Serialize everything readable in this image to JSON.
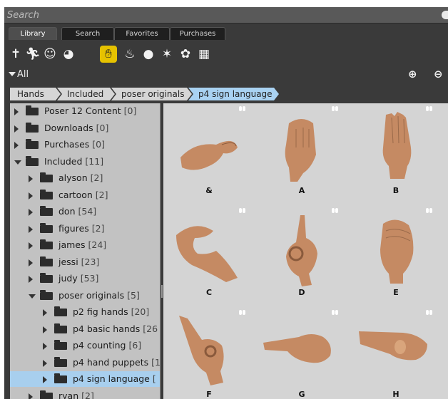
{
  "search": {
    "placeholder": "Search"
  },
  "tabs": [
    {
      "label": "Library"
    },
    {
      "label": "Search"
    },
    {
      "label": "Favorites"
    },
    {
      "label": "Purchases"
    }
  ],
  "toolbar": {
    "icons": [
      "figure-icon",
      "pose-icon",
      "expression-icon",
      "hair-icon",
      "hand-icon",
      "props-icon",
      "light-icon",
      "camera-icon",
      "materials-icon",
      "scenes-icon"
    ],
    "active_icon": "hand-icon"
  },
  "filter": {
    "label": "All",
    "add_icon": "add-library-icon",
    "remove_icon": "remove-library-icon"
  },
  "breadcrumb": [
    "Hands",
    "Included",
    "poser originals",
    "p4 sign language"
  ],
  "tree": [
    {
      "label": "Poser 12 Content",
      "count": "[0]",
      "state": "collapsed",
      "level": 0
    },
    {
      "label": "Downloads",
      "count": "[0]",
      "state": "collapsed",
      "level": 0
    },
    {
      "label": "Purchases",
      "count": "[0]",
      "state": "collapsed",
      "level": 0
    },
    {
      "label": "Included",
      "count": "[11]",
      "state": "expanded",
      "level": 0
    },
    {
      "label": "alyson",
      "count": "[2]",
      "state": "collapsed",
      "level": 1
    },
    {
      "label": "cartoon",
      "count": "[2]",
      "state": "collapsed",
      "level": 1
    },
    {
      "label": "don",
      "count": "[54]",
      "state": "collapsed",
      "level": 1
    },
    {
      "label": "figures",
      "count": "[2]",
      "state": "collapsed",
      "level": 1
    },
    {
      "label": "james",
      "count": "[24]",
      "state": "collapsed",
      "level": 1
    },
    {
      "label": "jessi",
      "count": "[23]",
      "state": "collapsed",
      "level": 1
    },
    {
      "label": "judy",
      "count": "[53]",
      "state": "collapsed",
      "level": 1
    },
    {
      "label": "poser originals",
      "count": "[5]",
      "state": "expanded",
      "level": 1
    },
    {
      "label": "p2 fig hands",
      "count": "[20]",
      "state": "collapsed",
      "level": 2
    },
    {
      "label": "p4 basic hands",
      "count": "[26",
      "state": "collapsed",
      "level": 2
    },
    {
      "label": "p4 counting",
      "count": "[6]",
      "state": "collapsed",
      "level": 2
    },
    {
      "label": "p4 hand puppets",
      "count": "[1",
      "state": "collapsed",
      "level": 2
    },
    {
      "label": "p4 sign language",
      "count": "[",
      "state": "collapsed",
      "level": 2,
      "selected": true
    },
    {
      "label": "ryan",
      "count": "[2]",
      "state": "collapsed",
      "level": 1
    }
  ],
  "items": [
    {
      "label": "&",
      "thumb": "hand-ampersand"
    },
    {
      "label": "A",
      "thumb": "hand-a"
    },
    {
      "label": "B",
      "thumb": "hand-b"
    },
    {
      "label": "C",
      "thumb": "hand-c"
    },
    {
      "label": "D",
      "thumb": "hand-d"
    },
    {
      "label": "E",
      "thumb": "hand-e"
    },
    {
      "label": "F",
      "thumb": "hand-f"
    },
    {
      "label": "G",
      "thumb": "hand-g"
    },
    {
      "label": "H",
      "thumb": "hand-h"
    }
  ],
  "colors": {
    "selection": "#a8cfee",
    "active_tool": "#e6c200",
    "skin": "#c58a63"
  }
}
